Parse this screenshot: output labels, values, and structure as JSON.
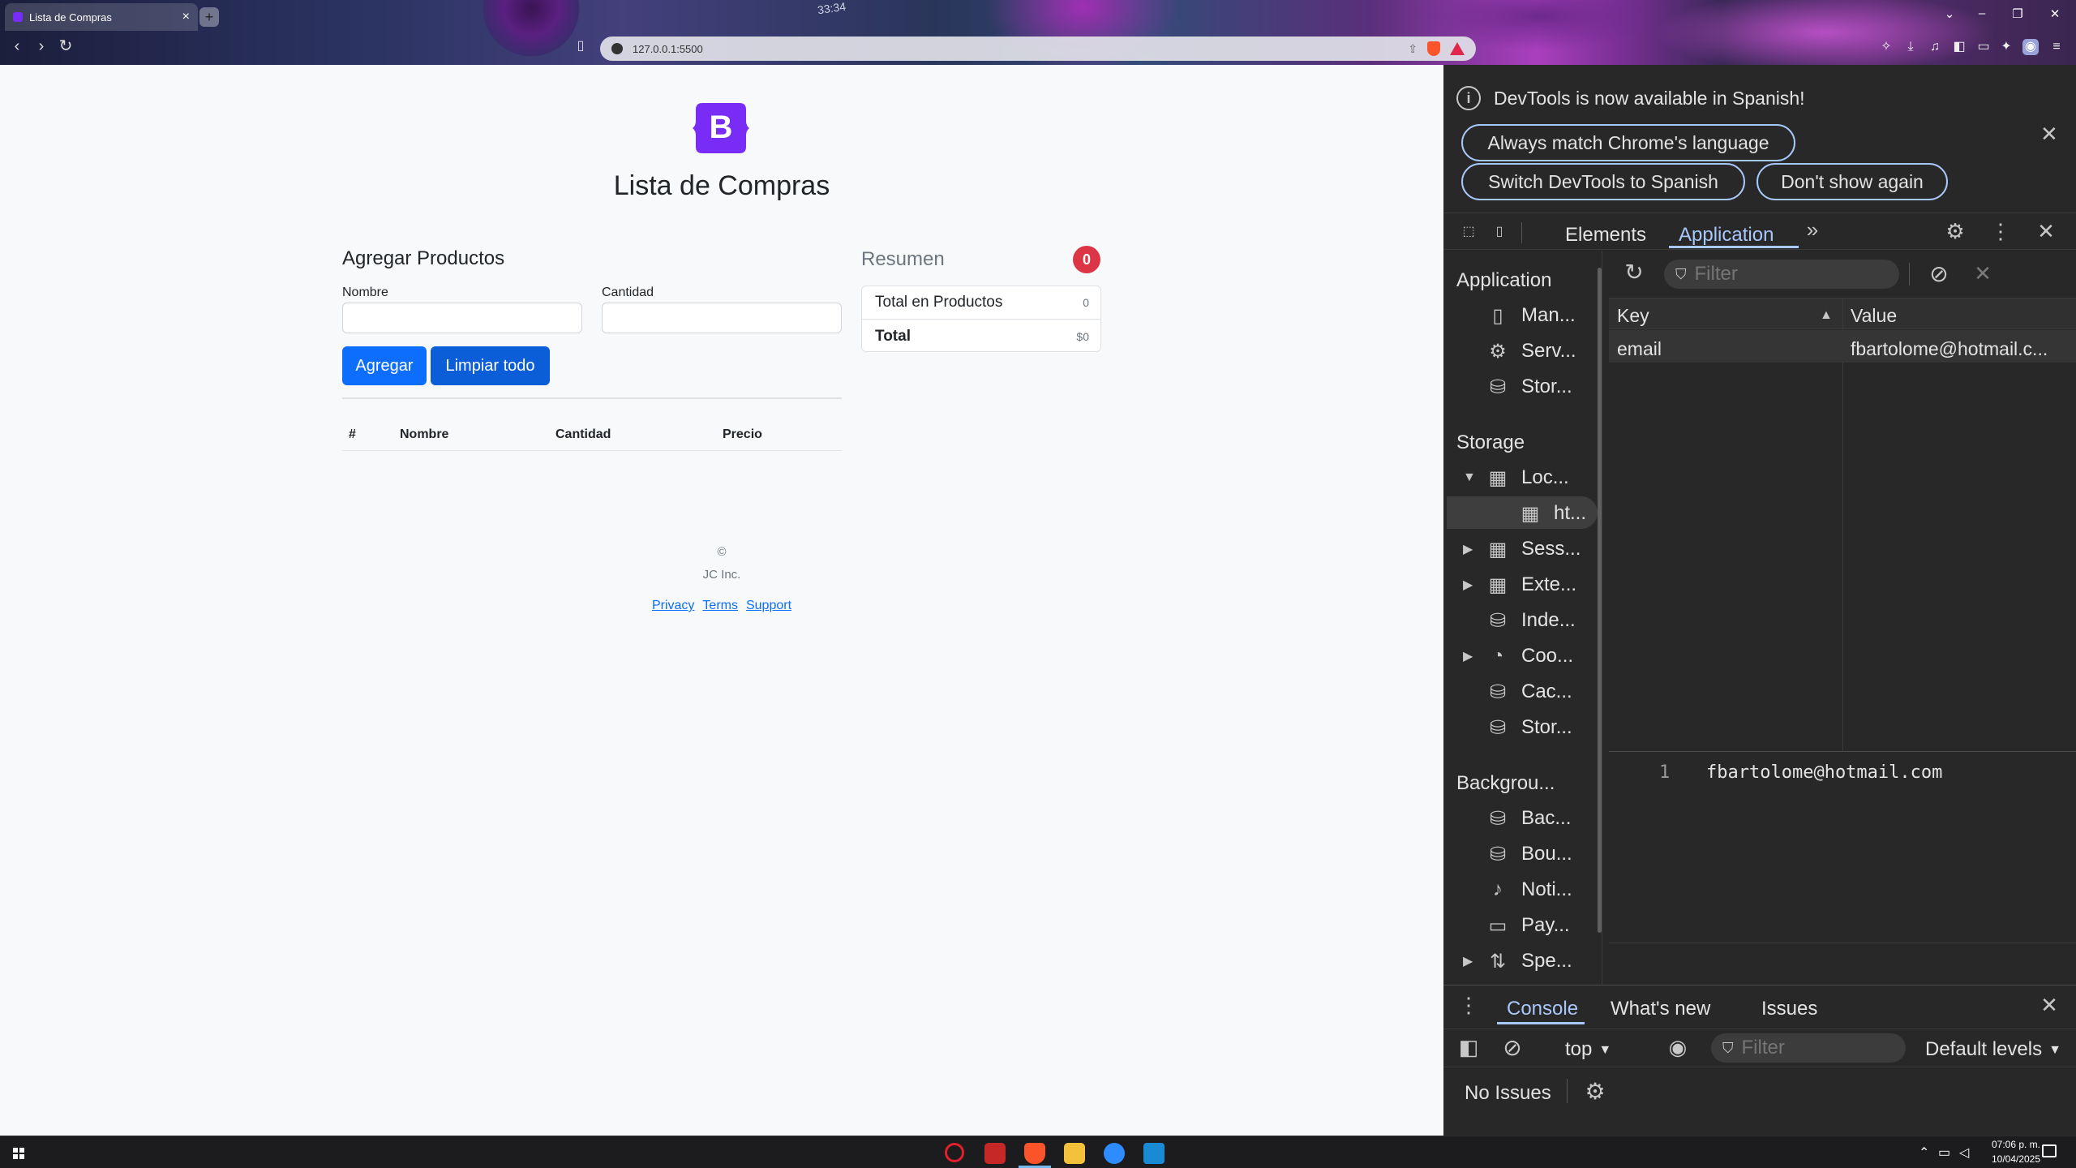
{
  "browser": {
    "tab_title": "Lista de Compras",
    "tab_close": "×",
    "new_tab": "+",
    "url": "127.0.0.1:5500",
    "video_timestamp": "33:34"
  },
  "page": {
    "logo_letter": "B",
    "title": "Lista de Compras",
    "form": {
      "heading": "Agregar Productos",
      "name_label": "Nombre",
      "name_value": "",
      "qty_label": "Cantidad",
      "qty_value": "",
      "add_button": "Agregar",
      "clear_button": "Limpiar todo"
    },
    "table": {
      "headers": [
        "#",
        "Nombre",
        "Cantidad",
        "Precio"
      ]
    },
    "summary": {
      "heading": "Resumen",
      "badge": "0",
      "rows": [
        {
          "label": "Total en Productos",
          "value": "0"
        },
        {
          "label": "Total",
          "value": "$0"
        }
      ]
    },
    "footer": {
      "copyright": "©",
      "company": "JC Inc.",
      "links": [
        "Privacy",
        "Terms",
        "Support"
      ]
    }
  },
  "devtools": {
    "infobar": {
      "message": "DevTools is now available in Spanish!",
      "buttons": [
        "Always match Chrome's language",
        "Switch DevTools to Spanish",
        "Don't show again"
      ]
    },
    "tabs": [
      "Elements",
      "Application"
    ],
    "active_tab": "Application",
    "filter_placeholder": "Filter",
    "sidebar": {
      "application_header": "Application",
      "application_items": [
        "Man...",
        "Serv...",
        "Stor..."
      ],
      "storage_header": "Storage",
      "storage_items": [
        "Loc...",
        "ht...",
        "Sess...",
        "Exte...",
        "Inde...",
        "Coo...",
        "Cac...",
        "Stor..."
      ],
      "background_header": "Backgrou...",
      "background_items": [
        "Bac...",
        "Bou...",
        "Noti...",
        "Pay...",
        "Spe..."
      ]
    },
    "storage_table": {
      "headers": [
        "Key",
        "Value"
      ],
      "rows": [
        {
          "key": "email",
          "value": "fbartolome@hotmail.c..."
        }
      ]
    },
    "preview": {
      "line": "1",
      "value": "fbartolome@hotmail.com"
    },
    "drawer": {
      "tabs": [
        "Console",
        "What's new",
        "Issues"
      ],
      "context": "top",
      "filter_placeholder": "Filter",
      "levels": "Default levels",
      "no_issues": "No Issues"
    }
  },
  "taskbar": {
    "time": "07:06 p. m.",
    "date": "10/04/2025"
  },
  "colors": {
    "primary": "#0d6efd",
    "danger": "#dc3545",
    "bootstrap_purple": "#7a2cf7",
    "devtools_bg": "#282828",
    "devtools_accent": "#a8c7fa"
  }
}
